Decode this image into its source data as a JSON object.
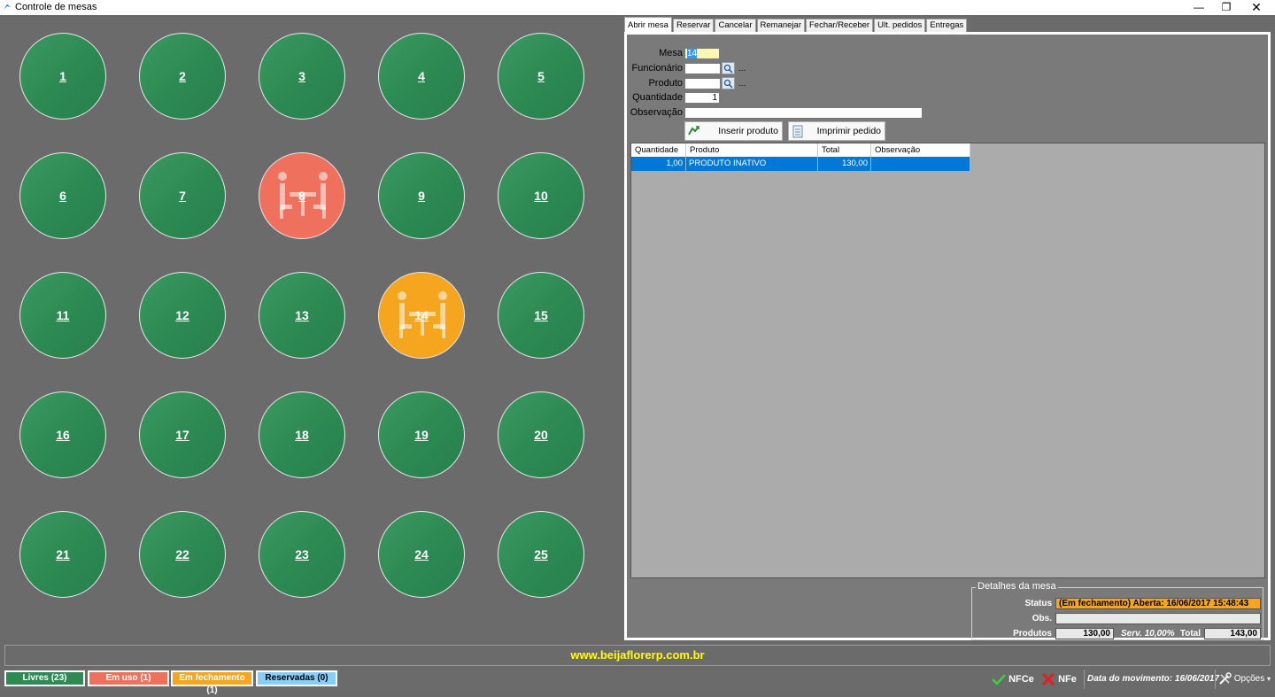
{
  "window": {
    "title": "Controle de mesas",
    "minimize": "—",
    "maximize": "❐",
    "close": "✕"
  },
  "tables": [
    {
      "num": "1",
      "status": "free"
    },
    {
      "num": "2",
      "status": "free"
    },
    {
      "num": "3",
      "status": "free"
    },
    {
      "num": "4",
      "status": "free"
    },
    {
      "num": "5",
      "status": "free"
    },
    {
      "num": "6",
      "status": "free"
    },
    {
      "num": "7",
      "status": "free"
    },
    {
      "num": "8",
      "status": "in-use"
    },
    {
      "num": "9",
      "status": "free"
    },
    {
      "num": "10",
      "status": "free"
    },
    {
      "num": "11",
      "status": "free"
    },
    {
      "num": "12",
      "status": "free"
    },
    {
      "num": "13",
      "status": "free"
    },
    {
      "num": "14",
      "status": "closing"
    },
    {
      "num": "15",
      "status": "free"
    },
    {
      "num": "16",
      "status": "free"
    },
    {
      "num": "17",
      "status": "free"
    },
    {
      "num": "18",
      "status": "free"
    },
    {
      "num": "19",
      "status": "free"
    },
    {
      "num": "20",
      "status": "free"
    },
    {
      "num": "21",
      "status": "free"
    },
    {
      "num": "22",
      "status": "free"
    },
    {
      "num": "23",
      "status": "free"
    },
    {
      "num": "24",
      "status": "free"
    },
    {
      "num": "25",
      "status": "free"
    }
  ],
  "tabs": [
    "Abrir mesa",
    "Reservar",
    "Cancelar",
    "Remanejar",
    "Fechar/Receber",
    "Ult. pedidos",
    "Entregas"
  ],
  "form": {
    "mesa_label": "Mesa",
    "mesa_value": "14",
    "funcionario_label": "Funcionário",
    "funcionario_value": "",
    "produto_label": "Produto",
    "produto_value": "",
    "quantidade_label": "Quantidade",
    "quantidade_value": "1",
    "observacao_label": "Observação",
    "observacao_value": "",
    "ellipsis": "...",
    "insert_button": "Inserir produto",
    "print_button": "Imprimir pedido"
  },
  "grid": {
    "headers": [
      "Quantidade",
      "Produto",
      "Total",
      "Observação"
    ],
    "rows": [
      {
        "qty": "1,00",
        "product": "PRODUTO INATIVO",
        "total": "130,00",
        "obs": ""
      }
    ]
  },
  "details": {
    "legend": "Detalhes da mesa",
    "status_label": "Status",
    "status_value": "(Em fechamento) Aberta: 16/06/2017 15:48:43",
    "obs_label": "Obs.",
    "obs_value": "",
    "produtos_label": "Produtos",
    "produtos_value": "130,00",
    "serv_text": "Serv. 10,00%",
    "total_label": "Total",
    "total_value": "143,00"
  },
  "site": "www.beijaflorerp.com.br",
  "legend": {
    "free": "Livres (23)",
    "in_use": "Em uso (1)",
    "closing": "Em fechamento (1)",
    "reserved": "Reservadas (0)"
  },
  "statusbar": {
    "nfce": "NFCe",
    "nfe": "NFe",
    "date": "Data do movimento: 16/06/2017",
    "options": "Opções"
  },
  "colors": {
    "free": "#2d8a53",
    "in_use": "#f0705e",
    "closing": "#f5a51e",
    "reserved": "#87cefa",
    "selection": "#0078d7",
    "site_text": "#ffff00"
  }
}
